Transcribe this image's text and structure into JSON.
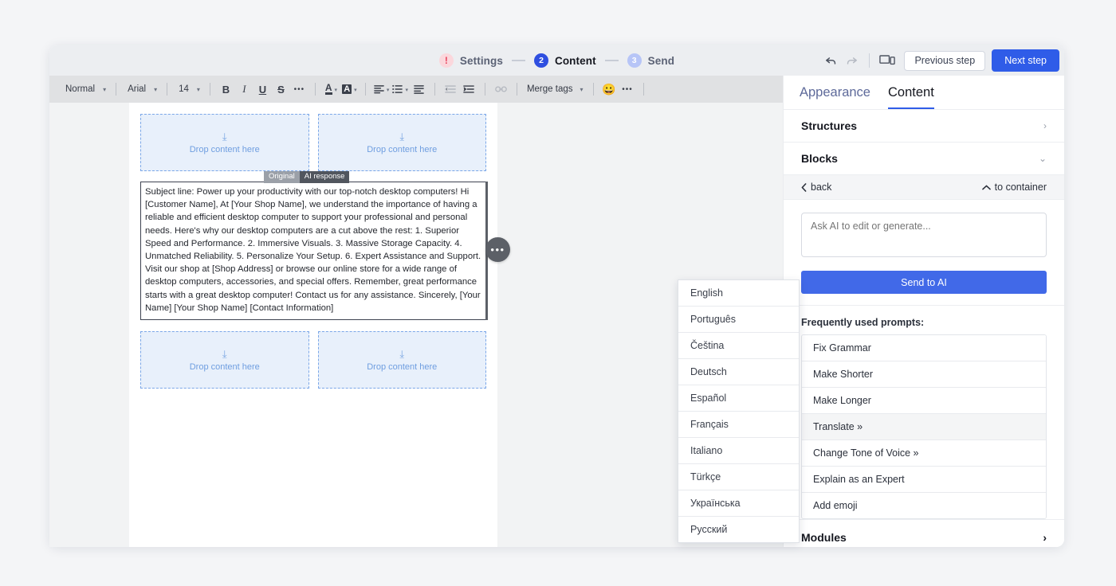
{
  "steps": [
    {
      "badge": "!",
      "label": "Settings",
      "state": "warning"
    },
    {
      "badge": "2",
      "label": "Content",
      "state": "active"
    },
    {
      "badge": "3",
      "label": "Send",
      "state": "upcoming"
    }
  ],
  "topbar": {
    "undo_icon": "undo-icon",
    "redo_icon": "redo-icon",
    "preview_icon": "device-preview-icon",
    "previous_step": "Previous step",
    "next_step": "Next step",
    "accent": "#2f5ce8"
  },
  "format_toolbar": {
    "paragraph_style": "Normal",
    "font_family": "Arial",
    "font_size": "14",
    "bold": "B",
    "italic": "I",
    "underline": "U",
    "strikethrough": "S",
    "more_text": "•••",
    "text_color": "A",
    "highlight_color": "A",
    "align": "align-left-icon",
    "list": "list-icon",
    "indent_block": "indent-icon",
    "outdent": "outdent-icon",
    "indent": "indent-more-icon",
    "link": "link-icon",
    "merge_tags": "Merge tags",
    "emoji": "😀",
    "more_tools": "•••"
  },
  "canvas": {
    "dropzones": [
      {
        "label": "Drop content here"
      },
      {
        "label": "Drop content here"
      },
      {
        "label": "Drop content here"
      },
      {
        "label": "Drop content here"
      }
    ],
    "block_tabs": {
      "original": "Original",
      "ai_response": "AI response"
    },
    "ai_text": "Subject line: Power up your productivity with our top-notch desktop computers! Hi [Customer Name], At [Your Shop Name], we understand the importance of having a reliable and efficient desktop computer to support your professional and personal needs. Here's why our desktop computers are a cut above the rest: 1. Superior Speed and Performance. 2. Immersive Visuals. 3. Massive Storage Capacity. 4. Unmatched Reliability. 5. Personalize Your Setup. 6. Expert Assistance and Support. Visit our shop at [Shop Address] or browse our online store for a wide range of desktop computers, accessories, and special offers. Remember, great performance starts with a great desktop computer! Contact us for any assistance. Sincerely, [Your Name] [Your Shop Name] [Contact Information]",
    "block_handle": "•••"
  },
  "sidebar": {
    "tabs": [
      {
        "label": "Appearance",
        "active": false
      },
      {
        "label": "Content",
        "active": true
      }
    ],
    "structures": {
      "label": "Structures",
      "chevron": "›"
    },
    "blocks": {
      "label": "Blocks",
      "chevron": "⌄"
    },
    "subbar": {
      "back": "back",
      "to_container": "to container"
    },
    "ai_placeholder": "Ask AI to edit or generate...",
    "send_button": "Send to AI",
    "prompts_label": "Frequently used prompts:",
    "prompts": [
      {
        "label": "Fix Grammar",
        "hover": false
      },
      {
        "label": "Make Shorter",
        "hover": false
      },
      {
        "label": "Make Longer",
        "hover": false
      },
      {
        "label": "Translate »",
        "hover": true
      },
      {
        "label": "Change Tone of Voice »",
        "hover": false
      },
      {
        "label": "Explain as an Expert",
        "hover": false
      },
      {
        "label": "Add emoji",
        "hover": false
      }
    ],
    "modules": {
      "label": "Modules",
      "chevron": "›"
    }
  },
  "language_menu": {
    "items": [
      "English",
      "Português",
      "Čeština",
      "Deutsch",
      "Español",
      "Français",
      "Italiano",
      "Türkçe",
      "Українська",
      "Русский"
    ]
  }
}
